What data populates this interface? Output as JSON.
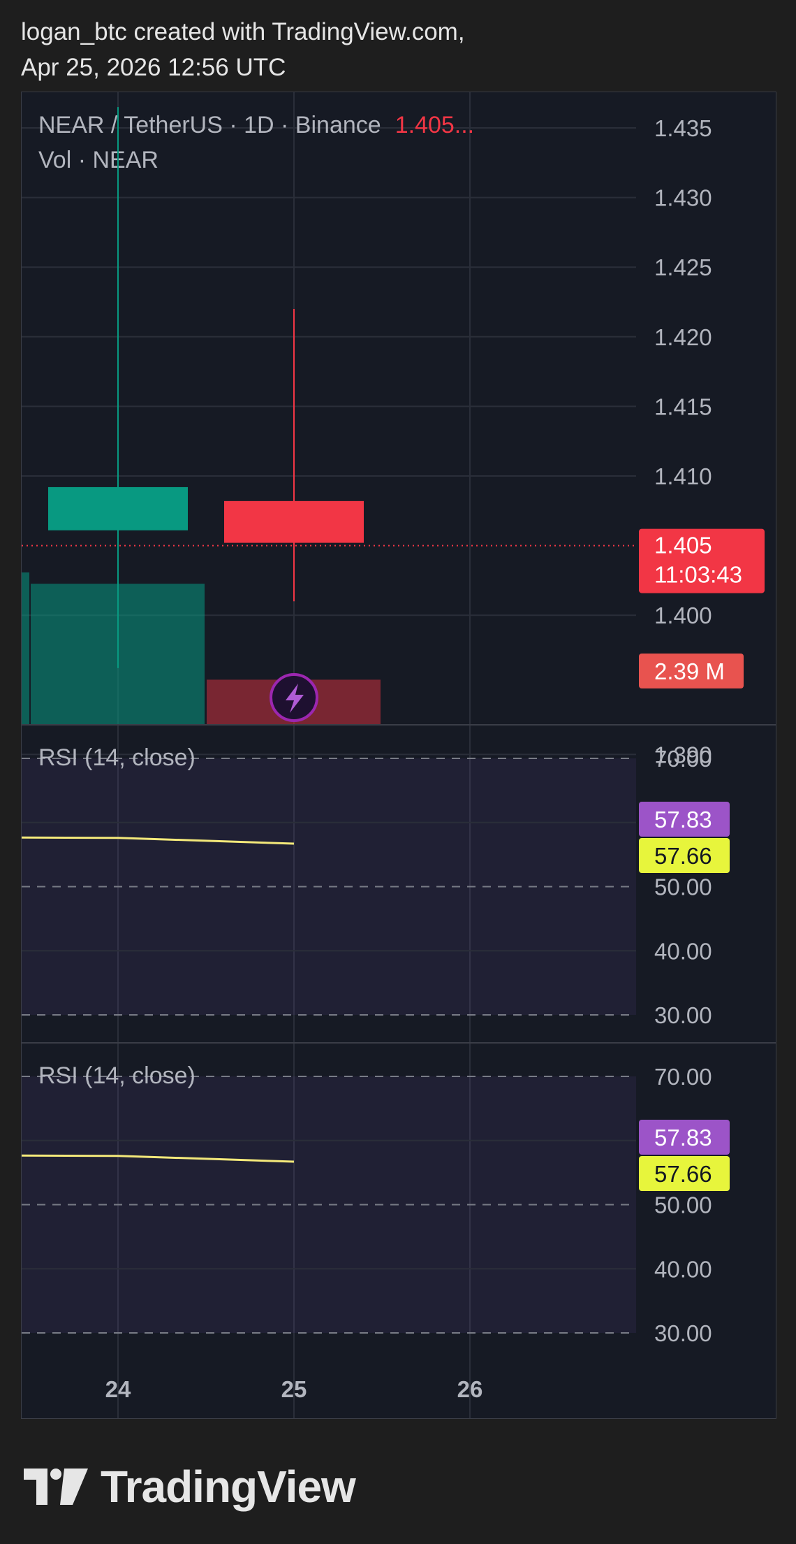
{
  "header": {
    "line1": "logan_btc created with TradingView.com,",
    "line2": "Apr 25, 2026 12:56 UTC"
  },
  "logo_text": "TradingView",
  "colors": {
    "up": "#089981",
    "down": "#f23645",
    "rsi_line": "#f4e97a",
    "rsi_badge_purple": "#9c54c8",
    "rsi_badge_yellow": "#e7f53c",
    "price_badge": "#f23645",
    "volume_badge": "#e8534f",
    "event_marker": "#9c27b0"
  },
  "chart_data": [
    {
      "type": "candlestick",
      "title": "NEAR / TetherUS · 1D · Binance",
      "last_price_label": "1.405...",
      "volume_label": "Vol · NEAR",
      "x_ticks": [
        "24",
        "25",
        "26"
      ],
      "y_ticks": [
        "1.435",
        "1.430",
        "1.425",
        "1.420",
        "1.415",
        "1.410",
        "1.400",
        "1.390"
      ],
      "ylim": [
        1.3895,
        1.4365
      ],
      "candles": [
        {
          "date": "24",
          "open": 1.4061,
          "high": 1.4365,
          "low": 1.3962,
          "close": 1.4092
        },
        {
          "date": "25",
          "open": 1.4082,
          "high": 1.422,
          "low": 1.401,
          "close": 1.4052
        }
      ],
      "volume": [
        {
          "date": "23",
          "value": 2.7,
          "direction": "up"
        },
        {
          "date": "24",
          "value": 2.5,
          "direction": "up"
        },
        {
          "date": "25",
          "value": 0.8,
          "direction": "down"
        }
      ],
      "price_badge": {
        "value": "1.405",
        "countdown": "11:03:43"
      },
      "volume_badge": "2.39 M",
      "current_price": 1.405
    },
    {
      "type": "line",
      "title": "RSI (14, close)",
      "y_ticks": [
        "70.00",
        "60.00",
        "50.00",
        "40.00",
        "30.00"
      ],
      "ylim": [
        30,
        70
      ],
      "series": [
        {
          "x": [
            "23.45",
            "24",
            "25"
          ],
          "values": [
            57.66,
            57.6,
            56.7
          ]
        }
      ],
      "badges": [
        "57.83",
        "57.66"
      ]
    },
    {
      "type": "line",
      "title": "RSI (14, close)",
      "y_ticks": [
        "70.00",
        "60.00",
        "50.00",
        "40.00",
        "30.00"
      ],
      "ylim": [
        30,
        70
      ],
      "series": [
        {
          "x": [
            "23.45",
            "24",
            "25"
          ],
          "values": [
            57.66,
            57.6,
            56.7
          ]
        }
      ],
      "badges": [
        "57.83",
        "57.66"
      ]
    }
  ]
}
